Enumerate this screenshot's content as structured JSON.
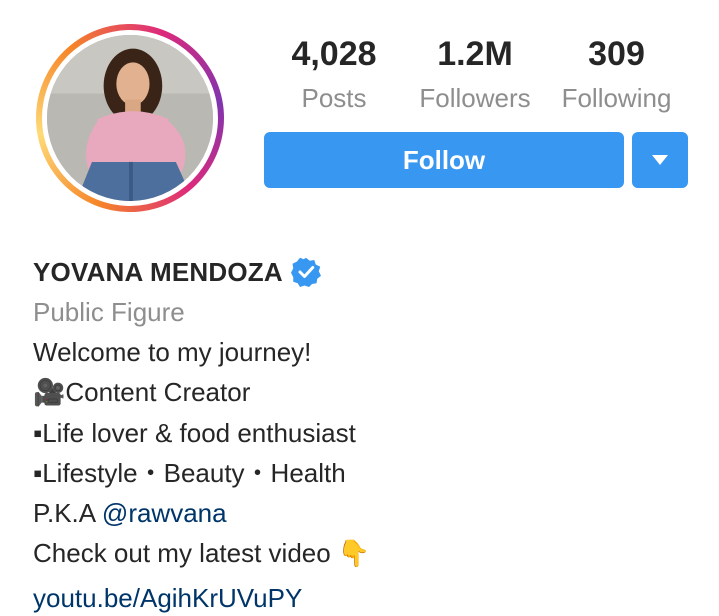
{
  "profile": {
    "name": "YOVANA MENDOZA",
    "verified": true,
    "category": "Public Figure"
  },
  "stats": {
    "posts": {
      "value": "4,028",
      "label": "Posts"
    },
    "followers": {
      "value": "1.2M",
      "label": "Followers"
    },
    "following": {
      "value": "309",
      "label": "Following"
    }
  },
  "actions": {
    "follow_label": "Follow",
    "dropdown_icon": "caret-down-icon"
  },
  "bio": {
    "line1": "Welcome to my journey!",
    "line2_icon": "🎥",
    "line2_text": "Content Creator",
    "line3": "▪Life lover & food enthusiast",
    "line4": "▪Lifestyle・Beauty・Health",
    "line5_prefix": "P.K.A ",
    "line5_mention": "@rawvana",
    "line6_text": "Check out my latest video ",
    "line6_emoji": "👇",
    "website": "youtu.be/AgihKrUVuPY"
  },
  "colors": {
    "accent": "#3897f0",
    "link": "#003569",
    "secondary_text": "#8e8e8e",
    "primary_text": "#262626",
    "verified_badge": "#3897f0"
  }
}
